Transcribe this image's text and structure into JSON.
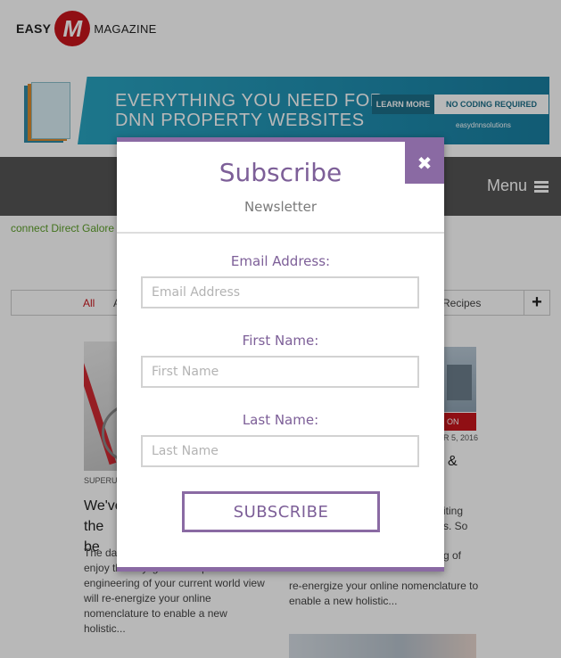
{
  "header": {
    "logo_left": "EASY",
    "logo_mark": "M",
    "logo_right": "MAGAZINE"
  },
  "banner": {
    "headline_1": "EVERYTHING YOU NEED FOR",
    "headline_2": "DNN PROPERTY WEBSITES",
    "cta_1": "LEARN MORE",
    "cta_2": "NO CODING REQUIRED",
    "brand": "easydnnsolutions"
  },
  "nav": {
    "menu_label": "Menu"
  },
  "sidebar_link": "connect Direct Galore",
  "filter": {
    "all": "All",
    "partial": "A",
    "recipes": "Recipes",
    "add": "+"
  },
  "article_left": {
    "meta": "SUPERUS",
    "title": "We've the be",
    "body": "The da for us t until next time, try to enjoy the daylight. Perhaps a re-engineering of your current world view will re-energize your online nomenclature to enable a new holistic..."
  },
  "article_right": {
    "badge": "ON",
    "date": "R 5, 2016",
    "title_amp": "&",
    "frag_1": "iting",
    "frag_2": "s. So",
    "frag_3": "g of",
    "body": "re-energize your online nomenclature to enable a new holistic..."
  },
  "modal": {
    "title": "Subscribe",
    "subtitle": "Newsletter",
    "close_symbol": "✖",
    "email_label": "Email Address:",
    "email_placeholder": "Email Address",
    "first_label": "First Name:",
    "first_placeholder": "First Name",
    "last_label": "Last Name:",
    "last_placeholder": "Last Name",
    "submit_label": "SUBSCRIBE"
  },
  "colors": {
    "accent": "#8a6aa3",
    "brand_red": "#c8161d",
    "nav_bg": "#555555"
  }
}
